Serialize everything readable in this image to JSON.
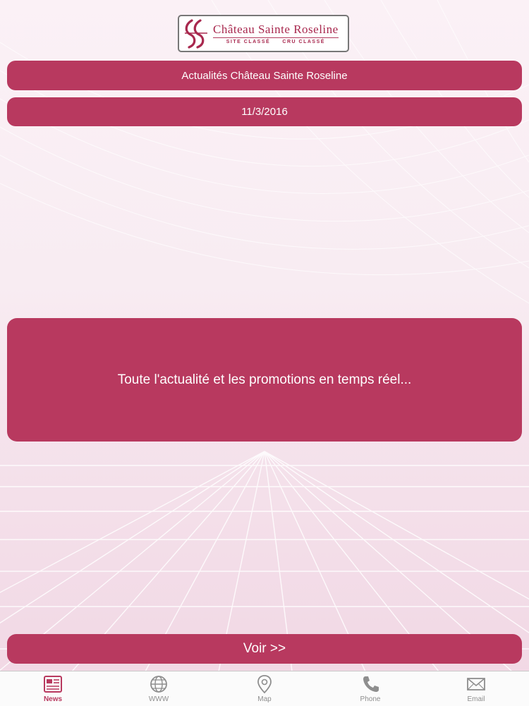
{
  "brand": {
    "name": "Château Sainte Roseline",
    "subtitle_left": "SITE CLASSÉ",
    "subtitle_right": "CRU CLASSÉ"
  },
  "header": {
    "title": "Actualités Château Sainte Roseline",
    "date": "11/3/2016"
  },
  "news": {
    "text": "Toute l'actualité et les promotions en temps réel..."
  },
  "actions": {
    "voir_label": "Voir >>"
  },
  "tabbar": {
    "items": [
      {
        "label": "News",
        "icon": "newspaper-icon",
        "active": true
      },
      {
        "label": "WWW",
        "icon": "globe-icon",
        "active": false
      },
      {
        "label": "Map",
        "icon": "map-pin-icon",
        "active": false
      },
      {
        "label": "Phone",
        "icon": "phone-icon",
        "active": false
      },
      {
        "label": "Email",
        "icon": "envelope-icon",
        "active": false
      }
    ]
  },
  "colors": {
    "accent": "#b8395f",
    "inactive": "#8e8e8e",
    "background": "#f6e6ef"
  }
}
